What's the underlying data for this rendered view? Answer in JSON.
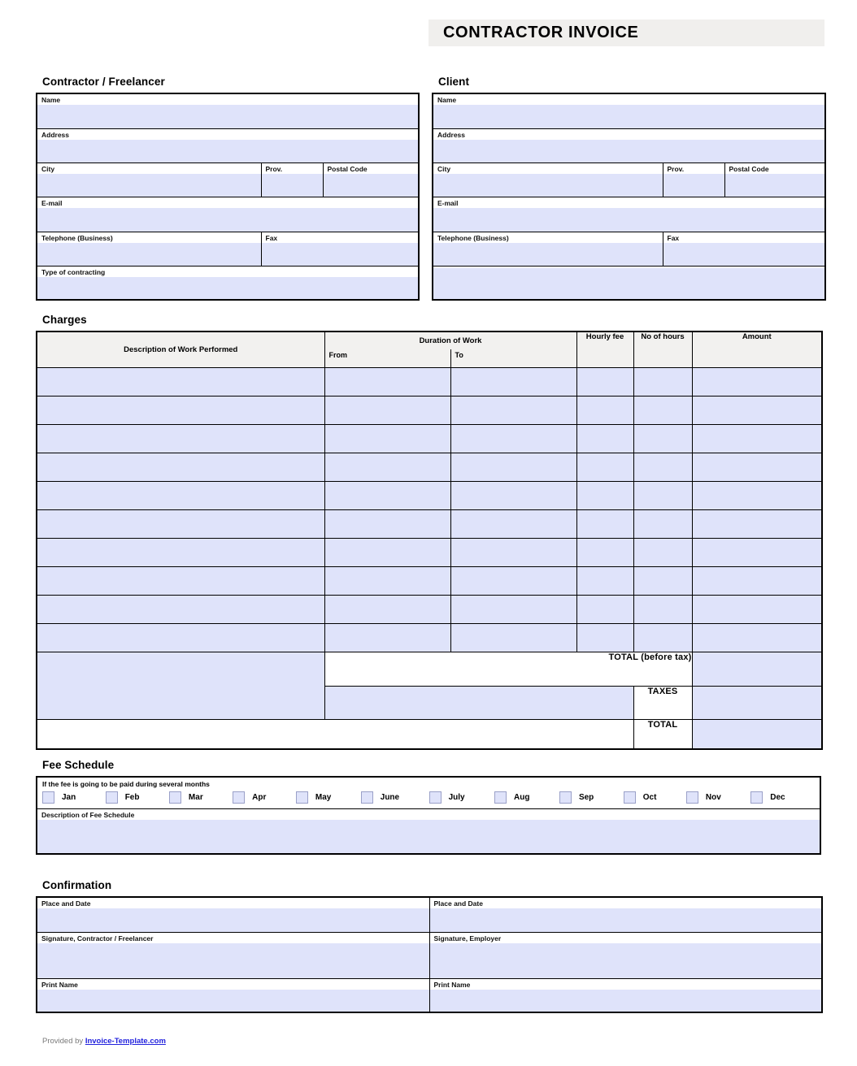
{
  "document": {
    "title": "CONTRACTOR INVOICE"
  },
  "contractor": {
    "heading": "Contractor / Freelancer",
    "fields": {
      "name": "Name",
      "address": "Address",
      "city": "City",
      "province": "Prov.",
      "postal_code": "Postal Code",
      "email": "E-mail",
      "telephone": "Telephone (Business)",
      "fax": "Fax",
      "type_of_contracting": "Type of contracting"
    }
  },
  "client": {
    "heading": "Client",
    "fields": {
      "name": "Name",
      "address": "Address",
      "city": "City",
      "province": "Prov.",
      "postal_code": "Postal Code",
      "email": "E-mail",
      "telephone": "Telephone (Business)",
      "fax": "Fax",
      "blank": ""
    }
  },
  "charges": {
    "heading": "Charges",
    "columns": {
      "description": "Description of Work Performed",
      "duration": "Duration of Work",
      "from": "From",
      "to": "To",
      "hourly_fee": "Hourly fee",
      "no_of_hours": "No of hours",
      "amount": "Amount"
    },
    "row_count": 10,
    "rows": [
      {
        "description": "",
        "from": "",
        "to": "",
        "hourly_fee": "",
        "no_of_hours": "",
        "amount": ""
      },
      {
        "description": "",
        "from": "",
        "to": "",
        "hourly_fee": "",
        "no_of_hours": "",
        "amount": ""
      },
      {
        "description": "",
        "from": "",
        "to": "",
        "hourly_fee": "",
        "no_of_hours": "",
        "amount": ""
      },
      {
        "description": "",
        "from": "",
        "to": "",
        "hourly_fee": "",
        "no_of_hours": "",
        "amount": ""
      },
      {
        "description": "",
        "from": "",
        "to": "",
        "hourly_fee": "",
        "no_of_hours": "",
        "amount": ""
      },
      {
        "description": "",
        "from": "",
        "to": "",
        "hourly_fee": "",
        "no_of_hours": "",
        "amount": ""
      },
      {
        "description": "",
        "from": "",
        "to": "",
        "hourly_fee": "",
        "no_of_hours": "",
        "amount": ""
      },
      {
        "description": "",
        "from": "",
        "to": "",
        "hourly_fee": "",
        "no_of_hours": "",
        "amount": ""
      },
      {
        "description": "",
        "from": "",
        "to": "",
        "hourly_fee": "",
        "no_of_hours": "",
        "amount": ""
      },
      {
        "description": "",
        "from": "",
        "to": "",
        "hourly_fee": "",
        "no_of_hours": "",
        "amount": ""
      }
    ],
    "totals": {
      "total_before_tax_label": "TOTAL (before tax)",
      "total_before_tax_value": "",
      "taxes_label": "TAXES",
      "taxes_value": "",
      "total_label": "TOTAL",
      "total_value": ""
    }
  },
  "fee_schedule": {
    "heading": "Fee Schedule",
    "intro": "If the fee is going to be paid during several months",
    "months": [
      {
        "label": "Jan",
        "checked": false
      },
      {
        "label": "Feb",
        "checked": false
      },
      {
        "label": "Mar",
        "checked": false
      },
      {
        "label": "Apr",
        "checked": false
      },
      {
        "label": "May",
        "checked": false
      },
      {
        "label": "June",
        "checked": false
      },
      {
        "label": "July",
        "checked": false
      },
      {
        "label": "Aug",
        "checked": false
      },
      {
        "label": "Sep",
        "checked": false
      },
      {
        "label": "Oct",
        "checked": false
      },
      {
        "label": "Nov",
        "checked": false
      },
      {
        "label": "Dec",
        "checked": false
      }
    ],
    "description_label": "Description of Fee Schedule",
    "description_value": ""
  },
  "confirmation": {
    "heading": "Confirmation",
    "left": {
      "place_and_date": "Place and Date",
      "signature": "Signature, Contractor / Freelancer",
      "print_name": "Print Name"
    },
    "right": {
      "place_and_date": "Place and Date",
      "signature": "Signature, Employer",
      "print_name": "Print Name"
    }
  },
  "footer": {
    "provided_by": "Provided by",
    "link_text": "Invoice-Template.com"
  },
  "colors": {
    "field_fill": "#dfe3fa",
    "header_fill": "#f2f1ef",
    "banner_fill": "#f0efed",
    "link": "#2222dd"
  }
}
